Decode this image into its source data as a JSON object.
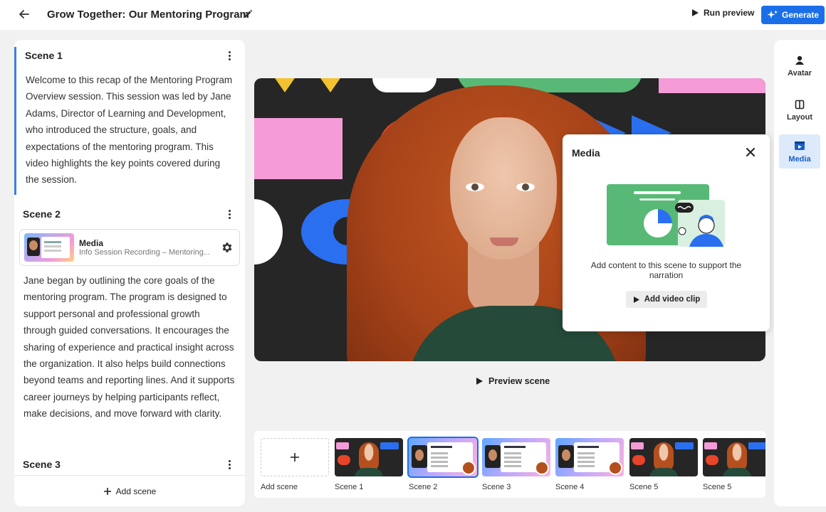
{
  "header": {
    "title": "Grow Together: Our Mentoring Program",
    "run_preview": "Run preview",
    "generate": "Generate"
  },
  "script": {
    "scenes": [
      {
        "title": "Scene 1",
        "text": "Welcome to this recap of the Mentoring Program Overview session. This session was led by Jane Adams, Director of Learning and Development, who introduced the structure, goals, and expectations of the mentoring program. This video highlights the key points covered during the session."
      },
      {
        "title": "Scene 2",
        "media": {
          "label": "Media",
          "name": "Info Session Recording – Mentoring..."
        },
        "text": "Jane began by outlining the core goals of the mentoring program. The program is designed to support personal and professional growth through guided conversations. It encourages the sharing of experience and practical insight across the organization. It also helps build connections beyond teams and reporting lines. And it supports career journeys by helping participants reflect, make decisions, and move forward with clarity."
      },
      {
        "title": "Scene 3"
      }
    ],
    "add_scene": "Add scene"
  },
  "preview": {
    "preview_scene": "Preview scene"
  },
  "media_popover": {
    "title": "Media",
    "description": "Add content to this scene to support the narration",
    "add_clip": "Add video clip"
  },
  "rail": {
    "items": [
      {
        "label": "Avatar",
        "icon": "person-icon"
      },
      {
        "label": "Layout",
        "icon": "layout-icon"
      },
      {
        "label": "Media",
        "icon": "media-icon",
        "active": true
      }
    ]
  },
  "strip": {
    "add_scene": "Add scene",
    "scenes": [
      {
        "label": "Scene 1",
        "kind": "avatar"
      },
      {
        "label": "Scene 2",
        "kind": "document",
        "selected": true
      },
      {
        "label": "Scene 3",
        "kind": "document"
      },
      {
        "label": "Scene 4",
        "kind": "document"
      },
      {
        "label": "Scene 5",
        "kind": "avatar"
      },
      {
        "label": "Scene 5",
        "kind": "avatar"
      }
    ]
  },
  "colors": {
    "accent": "#1a6fe8",
    "active_rail_bg": "#dceafc",
    "scene_marker": "#3d7fdc"
  }
}
